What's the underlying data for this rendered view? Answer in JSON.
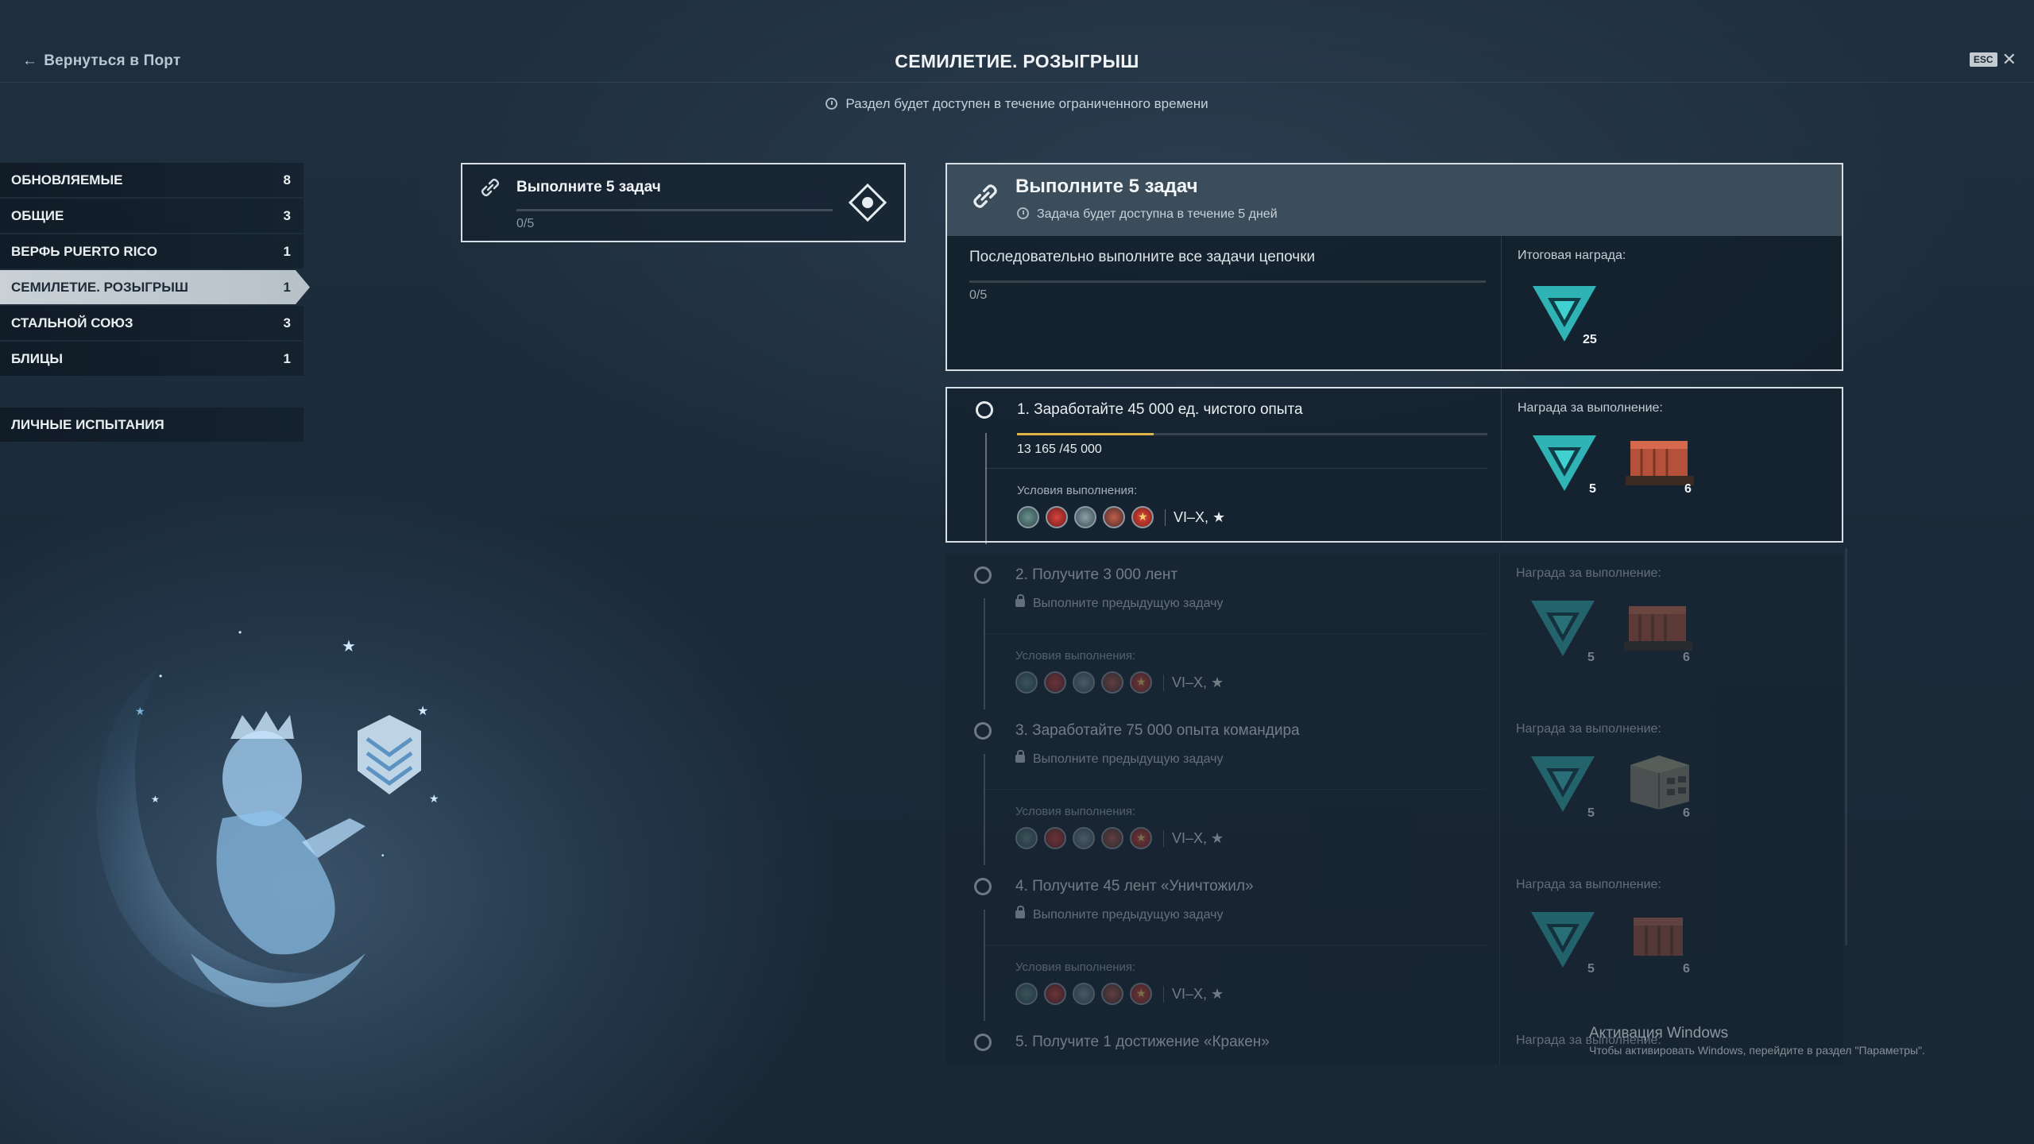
{
  "header": {
    "back_label": "Вернуться в Порт",
    "title": "СЕМИЛЕТИЕ. РОЗЫГРЫШ",
    "esc_label": "ESC",
    "notice": "Раздел будет доступен в течение ограниченного времени"
  },
  "sidebar": {
    "items": [
      {
        "label": "ОБНОВЛЯЕМЫЕ",
        "count": "8"
      },
      {
        "label": "ОБЩИЕ",
        "count": "3"
      },
      {
        "label": "ВЕРФЬ PUERTO RICO",
        "count": "1"
      },
      {
        "label": "СЕМИЛЕТИЕ. РОЗЫГРЫШ",
        "count": "1"
      },
      {
        "label": "СТАЛЬНОЙ СОЮЗ",
        "count": "3"
      },
      {
        "label": "БЛИЦЫ",
        "count": "1"
      }
    ],
    "personal": "ЛИЧНЫЕ ИСПЫТАНИЯ"
  },
  "chain_card": {
    "title": "Выполните 5 задач",
    "progress": "0/5"
  },
  "detail": {
    "title": "Выполните 5 задач",
    "subtitle": "Задача будет доступна в течение 5 дней",
    "description": "Последовательно выполните все задачи цепочки",
    "progress": "0/5",
    "reward_label": "Итоговая награда:",
    "reward_count": "25"
  },
  "tasks": [
    {
      "title": "1. Заработайте 45 000 ед. чистого опыта",
      "progress": "13 165 /45 000",
      "progress_fraction": 0.29,
      "conditions_label": "Условия выполнения:",
      "tiers": "VI–X, ★",
      "reward_label": "Награда за выполнение:",
      "reward1": "5",
      "reward2": "6"
    },
    {
      "title": "2. Получите 3 000 лент",
      "lock_text": "Выполните предыдущую задачу",
      "conditions_label": "Условия выполнения:",
      "tiers": "VI–X, ★",
      "reward_label": "Награда за выполнение:",
      "reward1": "5",
      "reward2": "6"
    },
    {
      "title": "3. Заработайте 75 000 опыта командира",
      "lock_text": "Выполните предыдущую задачу",
      "conditions_label": "Условия выполнения:",
      "tiers": "VI–X, ★",
      "reward_label": "Награда за выполнение:",
      "reward1": "5",
      "reward2": "6"
    },
    {
      "title": "4. Получите 45 лент «Уничтожил»",
      "lock_text": "Выполните предыдущую задачу",
      "conditions_label": "Условия выполнения:",
      "tiers": "VI–X, ★",
      "reward_label": "Награда за выполнение:",
      "reward1": "5",
      "reward2": "6"
    },
    {
      "title": "5. Получите 1 достижение «Кракен»",
      "reward_label": "Награда за выполнение:"
    }
  ],
  "watermark": {
    "line1": "Активация Windows",
    "line2": "Чтобы активировать Windows, перейдите в раздел \"Параметры\"."
  },
  "colors": {
    "accent": "#e0b347",
    "emblem": "#2fb3b5",
    "selected": "#c9d1d7"
  }
}
